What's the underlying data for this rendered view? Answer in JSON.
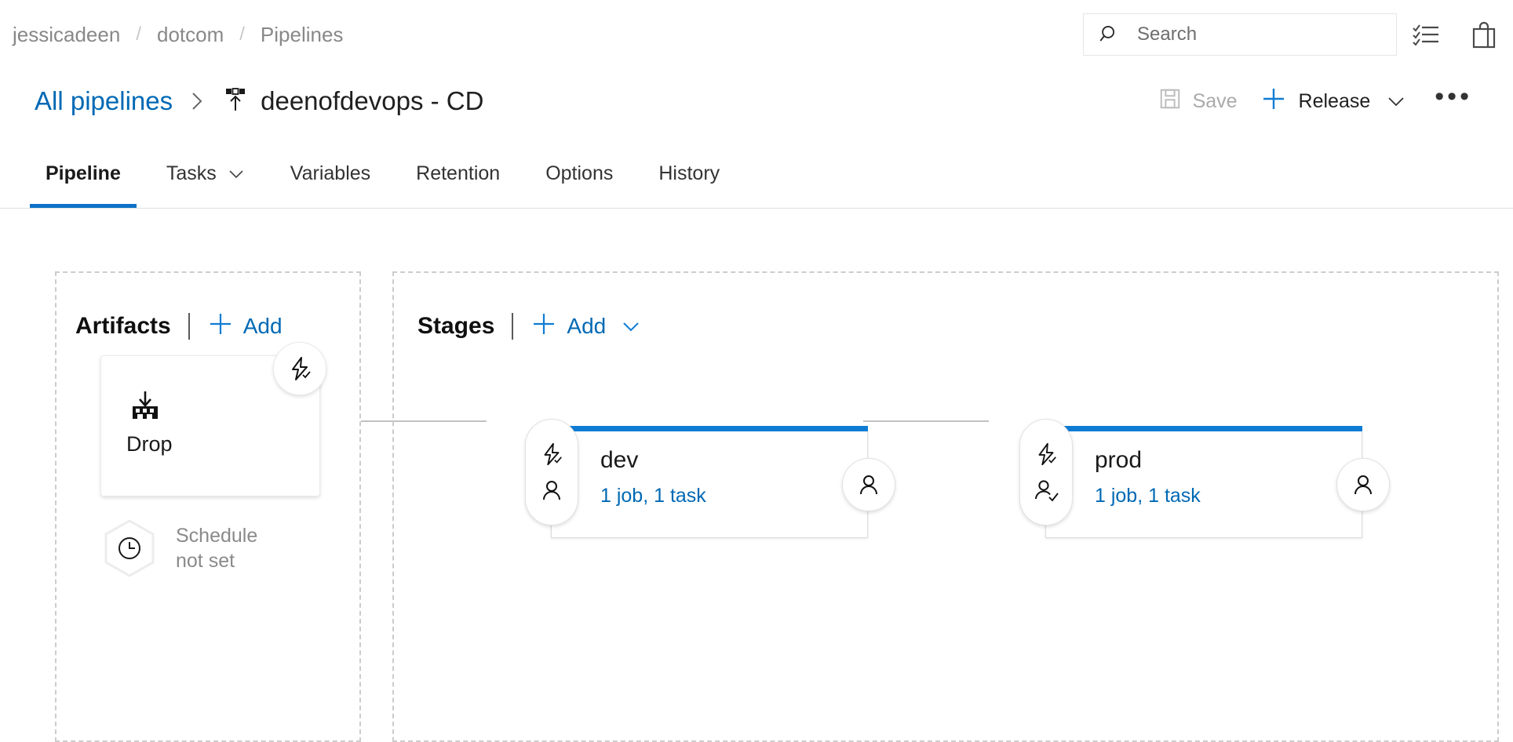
{
  "topbar": {
    "breadcrumb": [
      {
        "label": "jessicadeen"
      },
      {
        "label": "dotcom"
      },
      {
        "label": "Pipelines"
      }
    ],
    "separator": "/",
    "search": {
      "placeholder": "Search",
      "value": "",
      "icon": "search-icon"
    },
    "icons": [
      {
        "name": "tasks-checklist-icon"
      },
      {
        "name": "marketplace-bag-icon"
      }
    ]
  },
  "header": {
    "back_link": "All pipelines",
    "separator_icon": "chevron-right-icon",
    "release_icon": "release-pipeline-icon",
    "title": "deenofdevops - CD",
    "commands": {
      "save_label": "Save",
      "save_icon": "save-floppy-icon",
      "save_disabled": true,
      "release_label": "Release",
      "release_plus_icon": "plus-icon",
      "release_chevron_icon": "chevron-down-icon",
      "overflow_label": "•••"
    }
  },
  "tabs": [
    {
      "label": "Pipeline",
      "active": true,
      "chevron": false
    },
    {
      "label": "Tasks",
      "active": false,
      "chevron": true
    },
    {
      "label": "Variables",
      "active": false,
      "chevron": false
    },
    {
      "label": "Retention",
      "active": false,
      "chevron": false
    },
    {
      "label": "Options",
      "active": false,
      "chevron": false
    },
    {
      "label": "History",
      "active": false,
      "chevron": false
    }
  ],
  "artifacts_panel": {
    "title": "Artifacts",
    "add_label": "Add",
    "add_icon": "plus-icon",
    "card": {
      "name": "Drop",
      "icon": "build-artifact-icon",
      "trigger_badge_icon": "continuous-deployment-trigger-icon"
    },
    "schedule": {
      "icon": "clock-icon",
      "line1": "Schedule",
      "line2": "not set"
    }
  },
  "stages_panel": {
    "title": "Stages",
    "add_label": "Add",
    "add_icon": "plus-icon",
    "add_chevron_icon": "chevron-down-icon",
    "stages": [
      {
        "name": "dev",
        "summary": "1 job, 1 task",
        "pre_trigger_icon": "continuous-deployment-trigger-icon",
        "pre_approval_icon": "person-icon",
        "post_approval_icon": "person-icon"
      },
      {
        "name": "prod",
        "summary": "1 job, 1 task",
        "pre_trigger_icon": "continuous-deployment-trigger-icon",
        "pre_approval_icon": "person-check-icon",
        "post_approval_icon": "person-icon"
      }
    ]
  },
  "colors": {
    "accent_blue": "#0078d4",
    "link_blue": "#0069b4",
    "stage_bar_blue": "#0f7cd4",
    "tab_underline": "#0d72c7",
    "muted_text": "#888888",
    "panel_border": "#cccccc"
  }
}
